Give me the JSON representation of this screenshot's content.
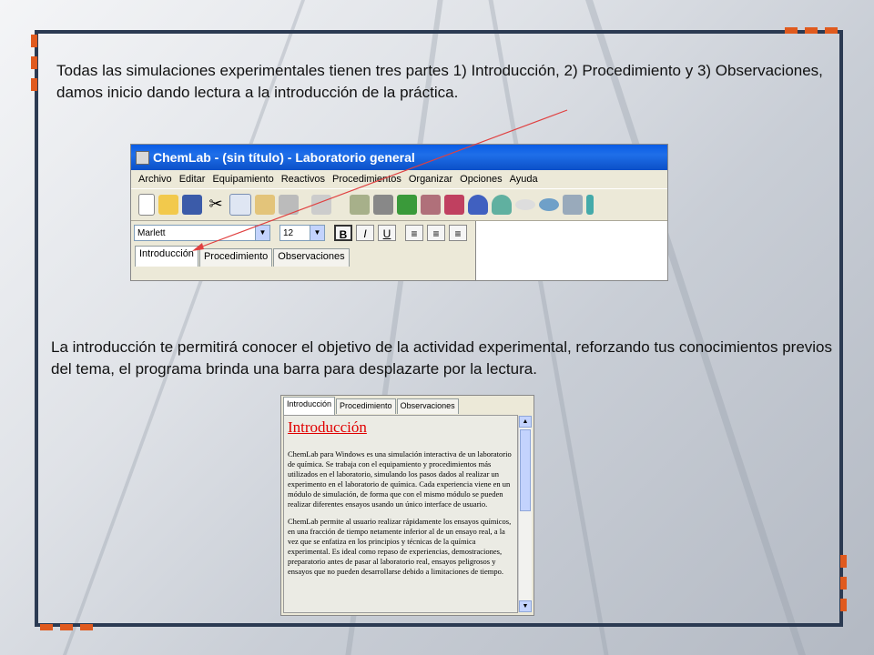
{
  "slide": {
    "paragraph1": "Todas las simulaciones experimentales tienen tres partes 1) Introducción, 2) Procedimiento y 3) Observaciones, damos inicio dando lectura a la introducción de la práctica.",
    "paragraph2": "La introducción te permitirá conocer el objetivo de la actividad experimental, reforzando tus conocimientos previos del tema, el programa brinda una barra para desplazarte por la lectura."
  },
  "colors": {
    "frame": "#2b3a52",
    "accent": "#e05a1e",
    "title_red": "#e00000",
    "arrow": "#e04040"
  },
  "app": {
    "title": "ChemLab - (sin título) - Laboratorio general",
    "menu": [
      "Archivo",
      "Editar",
      "Equipamiento",
      "Reactivos",
      "Procedimientos",
      "Organizar",
      "Opciones",
      "Ayuda"
    ],
    "font_name": "Marlett",
    "font_size": "12",
    "bold": "B",
    "italic": "I",
    "underline": "U",
    "tabs": [
      "Introducción",
      "Procedimiento",
      "Observaciones"
    ]
  },
  "zoom": {
    "tabs": [
      "Introducción",
      "Procedimiento",
      "Observaciones"
    ],
    "heading": "Introducción",
    "p1": "ChemLab para Windows es una simulación interactiva de un laboratorio de química. Se trabaja con el equipamiento y procedimientos más utilizados en el laboratorio, simulando los pasos dados al realizar un experimento en el laboratorio de química. Cada experiencia viene en un módulo de simulación, de forma que con el mismo módulo se pueden realizar diferentes ensayos usando un único interface de usuario.",
    "p2": "ChemLab permite al usuario realizar rápidamente los ensayos químicos, en una fracción de tiempo netamente inferior al de un ensayo real, a la vez que se enfatiza en los principios y técnicas de la química experimental. Es ideal como repaso de experiencias, demostraciones, preparatorio antes de pasar al laboratorio real, ensayos peligrosos y ensayos que no pueden desarrollarse debido a limitaciones de tiempo."
  }
}
